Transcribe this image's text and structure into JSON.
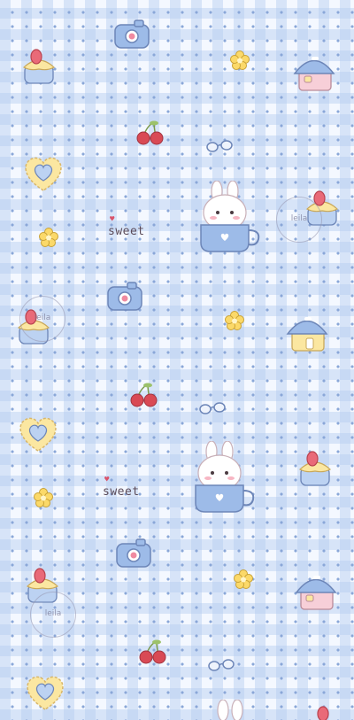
{
  "wallpaper": {
    "colors": {
      "background": "#f4f8ff",
      "gingham": "#b4ccf0",
      "dots": "#8aa7d8",
      "accent_blue": "#9dbbe8",
      "accent_yellow": "#fbe7a1",
      "accent_pink": "#f7cfd8",
      "cherry_red": "#d94a55"
    },
    "text": {
      "sweet_label": "sweet",
      "watermark_label": "leila"
    },
    "icons": [
      "camera-icon",
      "cupcake-icon",
      "flower-icon",
      "house-icon",
      "cherry-icon",
      "glasses-icon",
      "heart-cookie-icon",
      "bunny-cup-icon"
    ]
  }
}
